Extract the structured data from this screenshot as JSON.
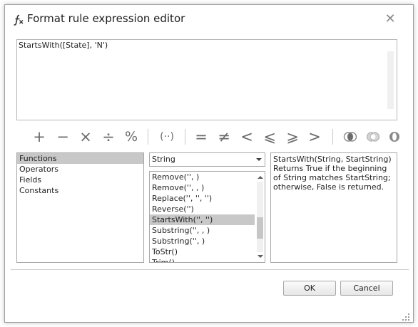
{
  "window": {
    "title": "Format rule expression editor",
    "title_icon": "function-icon",
    "close_glyph": "✕"
  },
  "expression": {
    "value": "StartsWith([State], 'N')"
  },
  "toolbar": {
    "buttons": [
      {
        "name": "plus-button",
        "glyph": "+"
      },
      {
        "name": "minus-button",
        "glyph": "−"
      },
      {
        "name": "multiply-button",
        "glyph": "×"
      },
      {
        "name": "divide-button",
        "glyph": "÷"
      },
      {
        "name": "modulo-button",
        "glyph": "%"
      },
      {
        "name": "parentheses-button",
        "glyph": "(··)"
      },
      {
        "name": "equals-button",
        "glyph": "="
      },
      {
        "name": "not-equals-button",
        "glyph": "≠"
      },
      {
        "name": "less-than-button",
        "glyph": "<"
      },
      {
        "name": "less-equal-button",
        "glyph": "⩽"
      },
      {
        "name": "greater-equal-button",
        "glyph": "⩾"
      },
      {
        "name": "greater-than-button",
        "glyph": ">"
      },
      {
        "name": "and-button",
        "icon": "logical-and-icon"
      },
      {
        "name": "or-button",
        "icon": "logical-or-icon"
      },
      {
        "name": "not-button",
        "icon": "logical-not-icon"
      }
    ]
  },
  "categories": {
    "items": [
      "Functions",
      "Operators",
      "Fields",
      "Constants"
    ],
    "selected_index": 0
  },
  "function_type": {
    "selected": "String"
  },
  "functions": {
    "items": [
      "Remove('', )",
      "Remove('', , )",
      "Replace('', '', '')",
      "Reverse('')",
      "StartsWith('', '')",
      "Substring('', , )",
      "Substring('', )",
      "ToStr()",
      "Trim()"
    ],
    "selected_index": 4,
    "scroll_position": 0.72
  },
  "description": {
    "text": "StartsWith(String, StartString)\nReturns True if the beginning of String matches StartString; otherwise, False is returned."
  },
  "footer": {
    "ok_label": "OK",
    "cancel_label": "Cancel"
  },
  "colors": {
    "selection": "#c8c8c8",
    "icon_gray": "#6b6b6b"
  }
}
